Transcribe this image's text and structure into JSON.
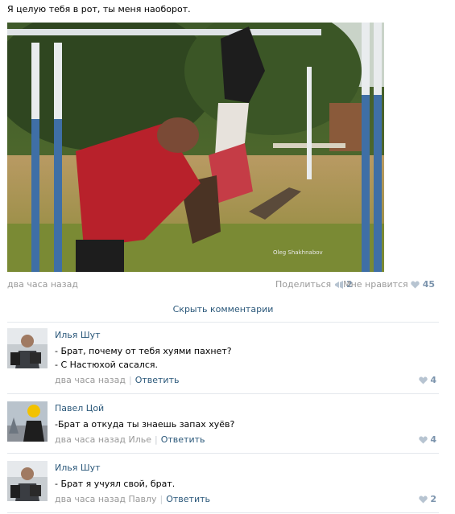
{
  "post": {
    "text": "Я целую тебя в рот, ты меня наоборот.",
    "photo_watermark": "Oleg Shakhnabov",
    "time": "два часа назад",
    "share_label": "Поделиться",
    "share_count": "2",
    "like_label": "Мне нравится",
    "like_count": "45"
  },
  "hide_comments_label": "Скрыть комментарии",
  "comments": [
    {
      "author": "Илья Шут",
      "lines": [
        "- Брат, почему от тебя хуями пахнет?",
        "- С Настюхой сасался."
      ],
      "time": "два часа назад",
      "reply_label": "Ответить",
      "likes": "4"
    },
    {
      "author": "Павел Цой",
      "lines": [
        "-Брат а откуда ты знаешь запах хуёв?"
      ],
      "time": "два часа назад Илье",
      "reply_label": "Ответить",
      "likes": "4"
    },
    {
      "author": "Илья Шут",
      "lines": [
        "- Брат я учуял свой, брат."
      ],
      "time": "два часа назад Павлу",
      "reply_label": "Ответить",
      "likes": "2"
    }
  ]
}
